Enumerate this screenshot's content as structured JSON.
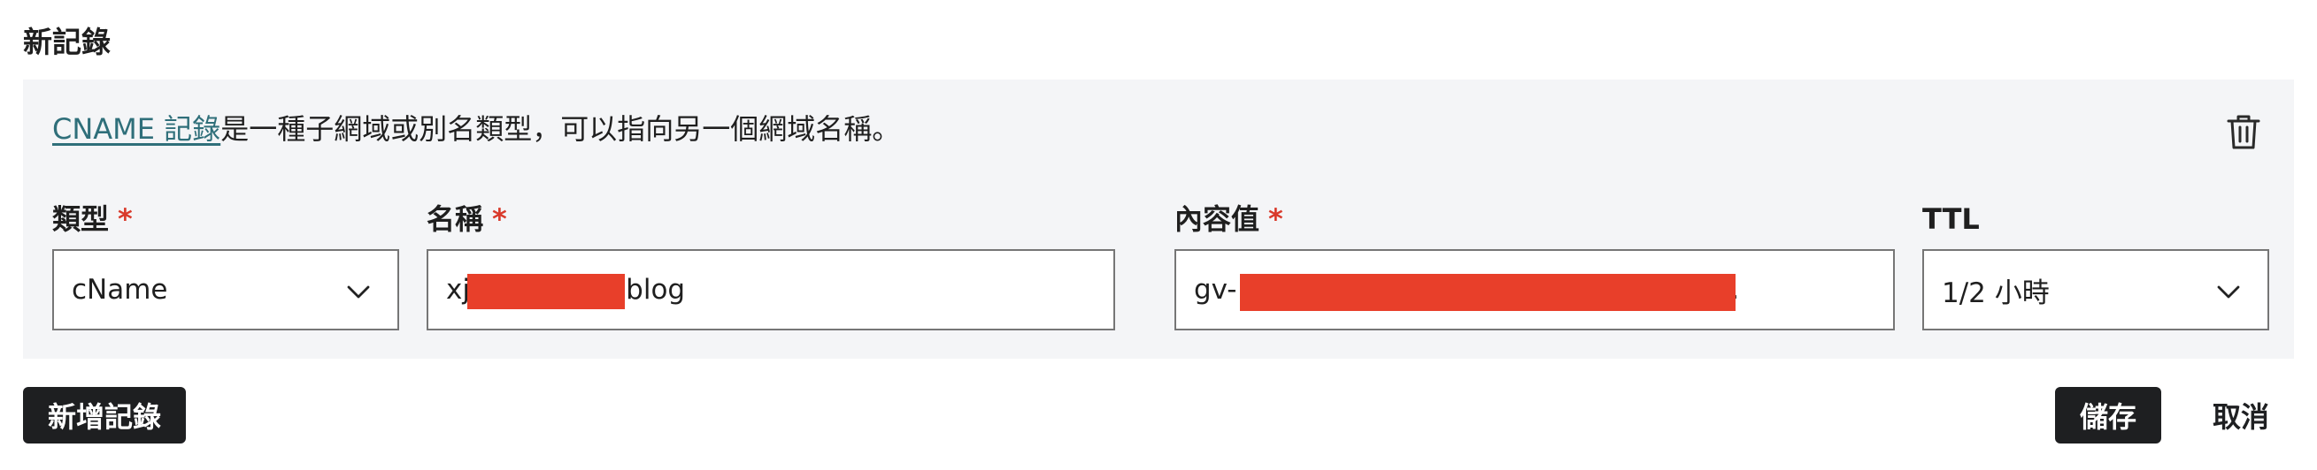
{
  "section": {
    "title": "新記錄"
  },
  "info": {
    "link_text": "CNAME 記錄",
    "description": "是一種子網域或別名類型，可以指向另一個網域名稱。"
  },
  "icons": {
    "delete": "trash-icon",
    "dropdown": "chevron-down-icon"
  },
  "fields": {
    "type": {
      "label": "類型",
      "required_mark": "*",
      "value": "cName"
    },
    "name": {
      "label": "名稱",
      "required_mark": "*",
      "value_prefix": "xj",
      "value_suffix": "x.blog"
    },
    "content": {
      "label": "內容值",
      "required_mark": "*",
      "value_prefix": "gv-",
      "value_suffix": "."
    },
    "ttl": {
      "label": "TTL",
      "value": "1/2 小時"
    }
  },
  "buttons": {
    "add_record": "新增記錄",
    "save": "儲存",
    "cancel": "取消"
  },
  "colors": {
    "accent_link": "#2f6f7a",
    "required": "#d93a2b",
    "redaction": "#e83f2a",
    "button_dark": "#1e1f21",
    "panel_bg": "#f4f5f7"
  }
}
